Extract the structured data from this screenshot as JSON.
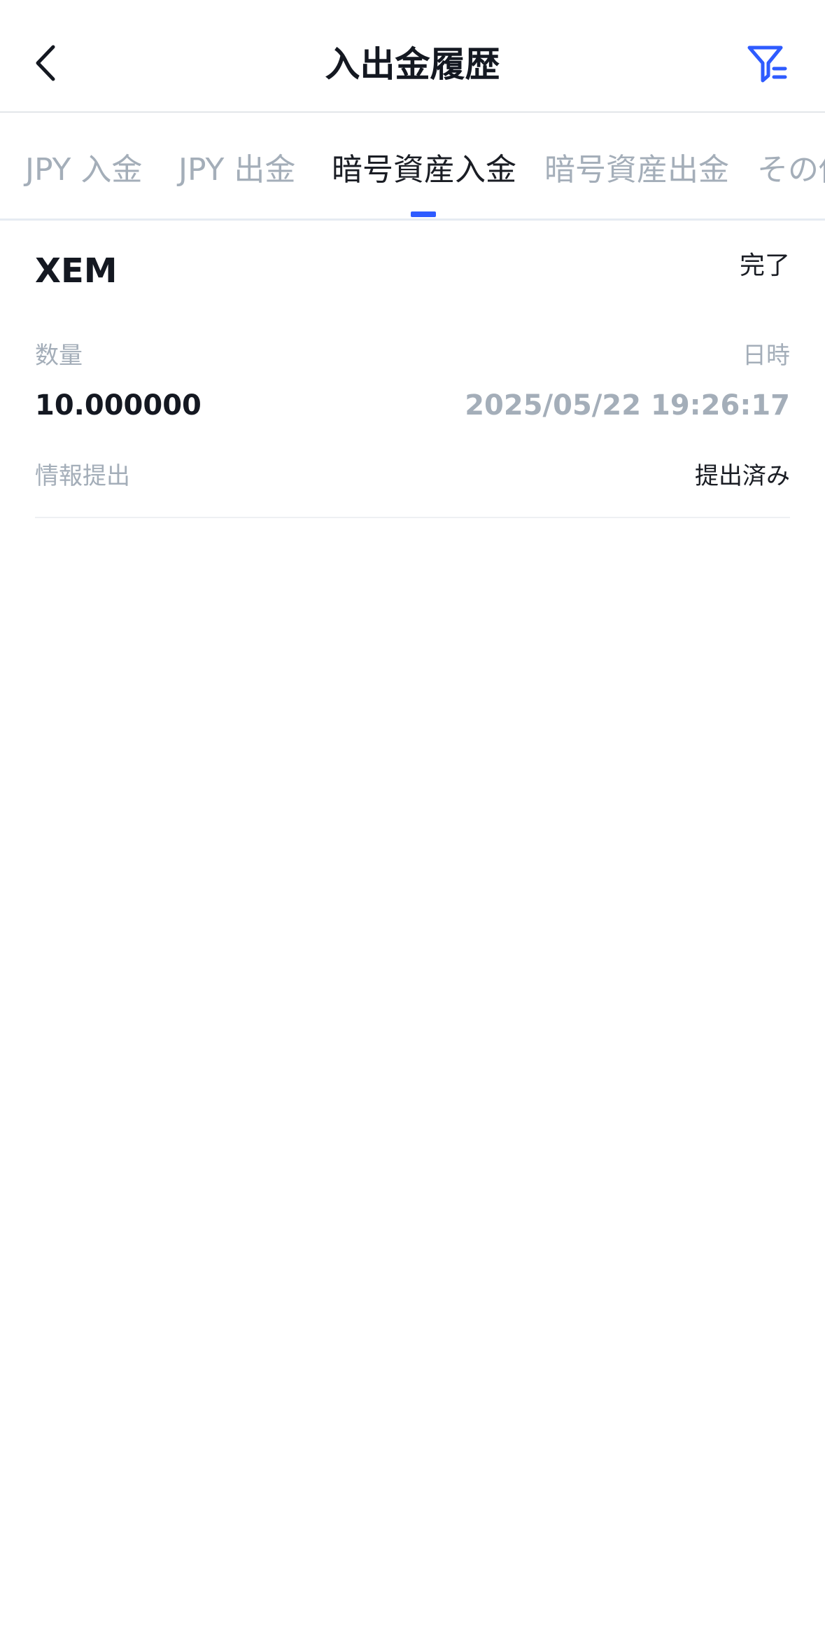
{
  "header": {
    "title": "入出金履歴",
    "back_icon": "chevron-left-icon",
    "filter_icon": "filter-icon",
    "accent_color": "#2e5bff"
  },
  "tabs": [
    {
      "label": "JPY 入金",
      "active": false
    },
    {
      "label": "JPY 出金",
      "active": false
    },
    {
      "label": "暗号資産入金",
      "active": true
    },
    {
      "label": "暗号資産出金",
      "active": false
    },
    {
      "label": "その他",
      "active": false
    }
  ],
  "record": {
    "coin": "XEM",
    "status": "完了",
    "quantity_label": "数量",
    "quantity_value": "10.000000",
    "datetime_label": "日時",
    "datetime_value": "2025/05/22 19:26:17",
    "info_label": "情報提出",
    "info_value": "提出済み"
  }
}
